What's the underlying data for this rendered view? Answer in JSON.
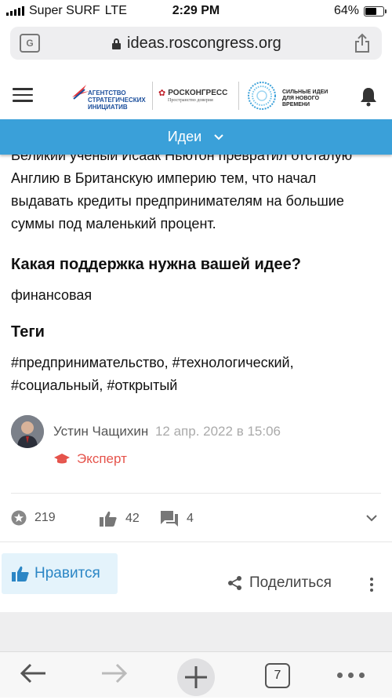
{
  "status": {
    "carrier": "Super SURF",
    "network": "LTE",
    "time": "2:29 PM",
    "battery": "64%",
    "battery_level": 0.64
  },
  "browser": {
    "url": "ideas.roscongress.org",
    "tab_count": "7"
  },
  "site_header": {
    "logo_asi": "АГЕНТСТВО СТРАТЕГИЧЕСКИХ ИНИЦИАТИВ",
    "logo_asi_lines": [
      "АГЕНТСТВО",
      "СТРАТЕГИЧЕСКИХ",
      "ИНИЦИАТИВ"
    ],
    "logo_roscongress": "РОСКОНГРЕСС",
    "logo_roscongress_sub": "Пространство доверия",
    "logo_ideas_lines": [
      "СИЛЬНЫЕ ИДЕИ",
      "ДЛЯ НОВОГО",
      "ВРЕМЕНИ"
    ]
  },
  "nav": {
    "section_label": "Идеи"
  },
  "idea": {
    "paragraph_lines": [
      "Великий ученый Исаак Ньютон превратил отсталую",
      "Англию в Британскую империю тем, что начал",
      "выдавать кредиты предпринимателям на большие",
      "суммы под маленький процент."
    ],
    "support_heading": "Какая поддержка нужна вашей идее?",
    "support_value": "финансовая",
    "tags_heading": "Теги",
    "tags_lines": [
      "#предпринимательство, #технологический,",
      "#социальный, #открытый"
    ]
  },
  "author": {
    "name": "Устин Чащихин",
    "date": "12 апр. 2022 в 15:06",
    "role": "Эксперт"
  },
  "stats": {
    "rating": "219",
    "likes": "42",
    "comments": "4"
  },
  "actions": {
    "like_label": "Нравится",
    "share_label": "Поделиться"
  },
  "colors": {
    "accent_blue": "#3aa0d9",
    "expert_red": "#e5534b",
    "like_bg": "#e4f3fb"
  }
}
